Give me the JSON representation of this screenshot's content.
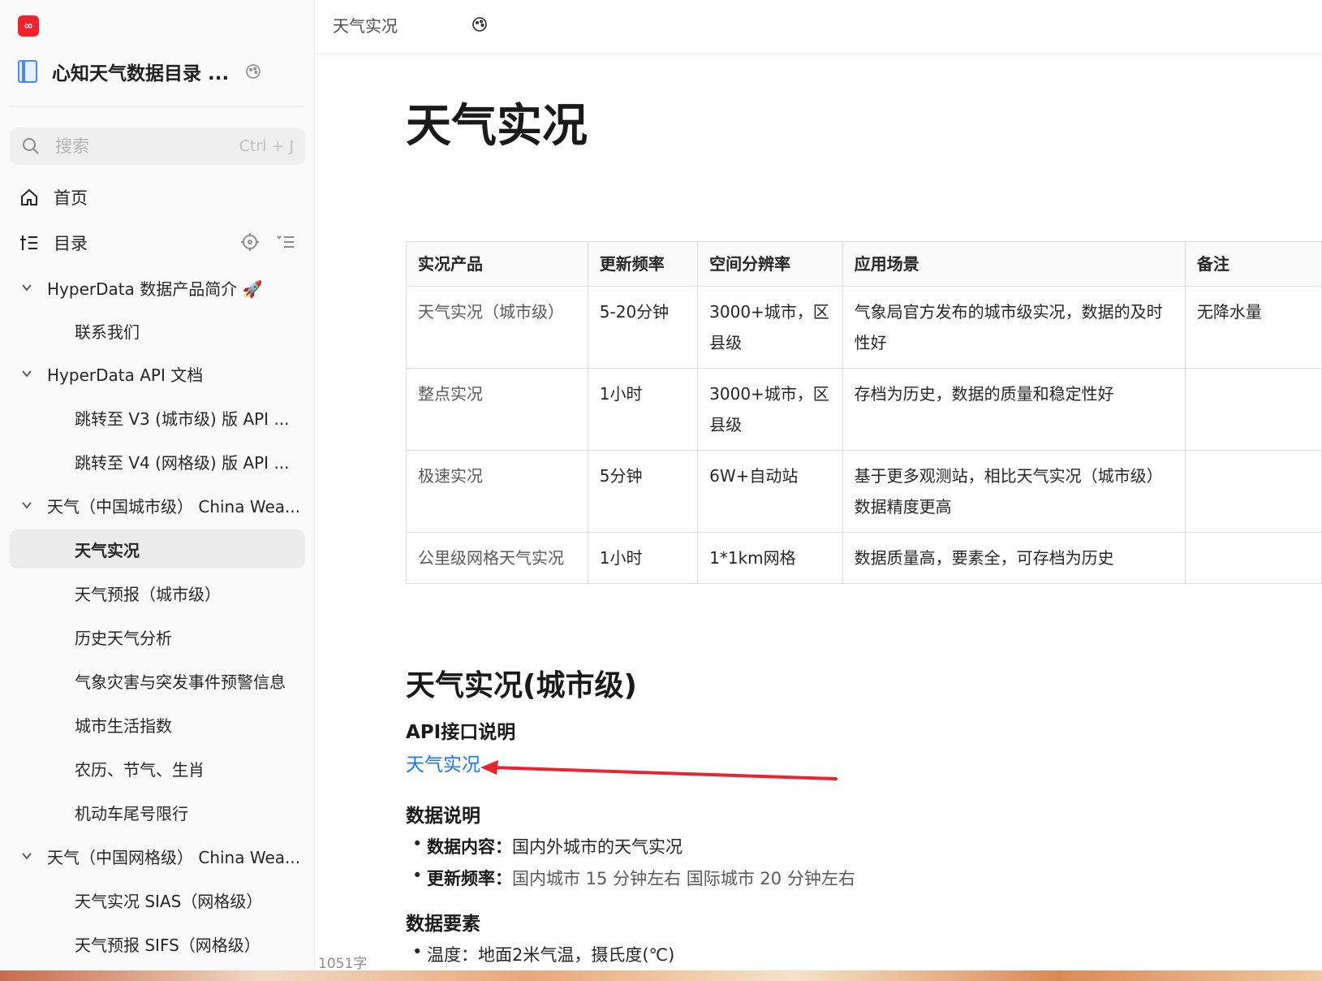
{
  "app": {
    "logo_text": "∞",
    "accent": "#f5222d"
  },
  "sidebar": {
    "kb_title": "心知天气数据目录 ...",
    "search": {
      "placeholder": "搜索",
      "shortcut": "Ctrl + J"
    },
    "home_label": "首页",
    "toc_label": "目录",
    "tree": [
      {
        "label": "HyperData 数据产品简介 🚀",
        "level": 1,
        "expanded": true
      },
      {
        "label": "联系我们",
        "level": 2
      },
      {
        "label": "HyperData API 文档",
        "level": 1,
        "expanded": true
      },
      {
        "label": "跳转至 V3 (城市级) 版 API ...",
        "level": 2
      },
      {
        "label": "跳转至 V4 (网格级) 版 API ...",
        "level": 2
      },
      {
        "label": "天气（中国城市级） China Wea...",
        "level": 1,
        "expanded": true
      },
      {
        "label": "天气实况",
        "level": 2,
        "active": true
      },
      {
        "label": "天气预报（城市级）",
        "level": 2
      },
      {
        "label": "历史天气分析",
        "level": 2
      },
      {
        "label": "气象灾害与突发事件预警信息",
        "level": 2
      },
      {
        "label": "城市生活指数",
        "level": 2
      },
      {
        "label": "农历、节气、生肖",
        "level": 2
      },
      {
        "label": "机动车尾号限行",
        "level": 2
      },
      {
        "label": "天气（中国网格级） China Wea...",
        "level": 1,
        "expanded": true
      },
      {
        "label": "天气实况 SIAS（网格级）",
        "level": 2
      },
      {
        "label": "天气预报 SIFS（网格级）",
        "level": 2
      }
    ],
    "word_count": "1051字"
  },
  "topbar": {
    "breadcrumb": "天气实况"
  },
  "doc": {
    "title": "天气实况",
    "table": {
      "headers": [
        "实况产品",
        "更新频率",
        "空间分辨率",
        "应用场景",
        "备注"
      ],
      "rows": [
        [
          "天气实况（城市级）",
          "5-20分钟",
          "3000+城市，区县级",
          "气象局官方发布的城市级实况，数据的及时性好",
          "无降水量"
        ],
        [
          "整点实况",
          "1小时",
          "3000+城市，区县级",
          "存档为历史，数据的质量和稳定性好",
          ""
        ],
        [
          "极速实况",
          "5分钟",
          "6W+自动站",
          "基于更多观测站，相比天气实况（城市级）数据精度更高",
          ""
        ],
        [
          "公里级网格天气实况",
          "1小时",
          "1*1km网格",
          "数据质量高，要素全，可存档为历史",
          ""
        ]
      ]
    },
    "section_title": "天气实况(城市级)",
    "api_heading": "API接口说明",
    "api_link": "天气实况",
    "data_desc_heading": "数据说明",
    "data_desc": [
      {
        "key": "数据内容：",
        "value": "国内外城市的天气实况"
      },
      {
        "key": "更新频率：",
        "value": "国内城市 15 分钟左右 国际城市 20 分钟左右"
      }
    ],
    "elements_heading": "数据要素",
    "elements": [
      "温度：地面2米气温，摄氏度(℃)"
    ]
  },
  "colors": {
    "link": "#1677ff",
    "annotation_arrow": "#e8242f"
  }
}
